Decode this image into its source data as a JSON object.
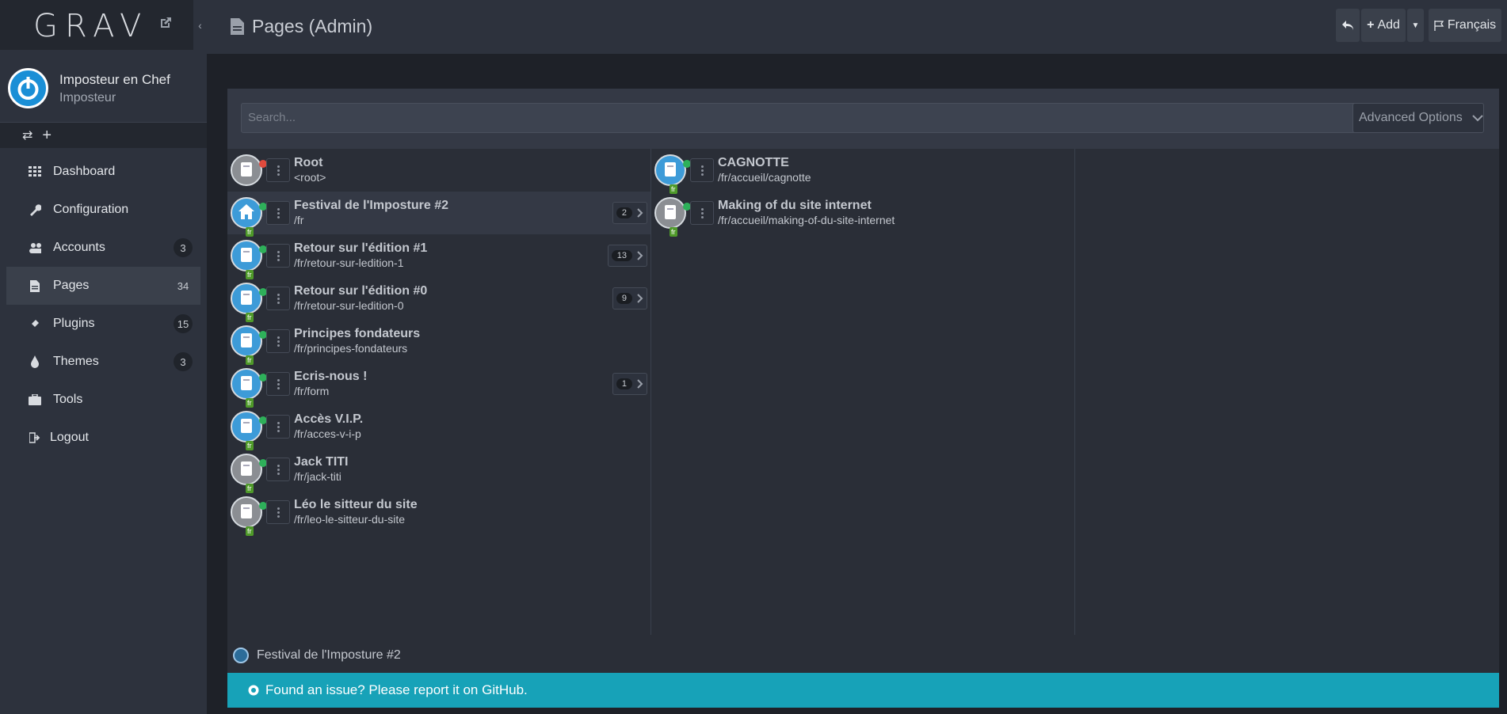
{
  "sidebar": {
    "logo": "GRAV",
    "user": {
      "name": "Imposteur en Chef",
      "role": "Imposteur"
    },
    "items": [
      {
        "label": "Dashboard",
        "icon": "dashboard-icon",
        "badge": ""
      },
      {
        "label": "Configuration",
        "icon": "wrench-icon",
        "badge": ""
      },
      {
        "label": "Accounts",
        "icon": "users-icon",
        "badge": "3"
      },
      {
        "label": "Pages",
        "icon": "file-icon",
        "badge": "34"
      },
      {
        "label": "Plugins",
        "icon": "plug-icon",
        "badge": "15"
      },
      {
        "label": "Themes",
        "icon": "tint-icon",
        "badge": "3"
      },
      {
        "label": "Tools",
        "icon": "briefcase-icon",
        "badge": ""
      },
      {
        "label": "Logout",
        "icon": "sign-out-icon",
        "badge": ""
      }
    ]
  },
  "header": {
    "title": "Pages (Admin)",
    "add_label": "Add",
    "lang_label": "Français"
  },
  "search": {
    "placeholder": "Search...",
    "advanced_label": "Advanced Options"
  },
  "pages_left": [
    {
      "title": "Root",
      "url": "<root>",
      "count": "",
      "lang": "",
      "color": "grey",
      "status": "red"
    },
    {
      "title": "Festival de l'Imposture #2",
      "url": "/fr",
      "count": "2",
      "lang": "fr",
      "color": "blue",
      "status": "green"
    },
    {
      "title": "Retour sur l'édition #1",
      "url": "/fr/retour-sur-ledition-1",
      "count": "13",
      "lang": "fr",
      "color": "blue",
      "status": "green"
    },
    {
      "title": "Retour sur l'édition #0",
      "url": "/fr/retour-sur-ledition-0",
      "count": "9",
      "lang": "fr",
      "color": "blue",
      "status": "green"
    },
    {
      "title": "Principes fondateurs",
      "url": "/fr/principes-fondateurs",
      "count": "",
      "lang": "fr",
      "color": "blue",
      "status": "green"
    },
    {
      "title": "Ecris-nous !",
      "url": "/fr/form",
      "count": "1",
      "lang": "fr",
      "color": "blue",
      "status": "green"
    },
    {
      "title": "Accès V.I.P.",
      "url": "/fr/acces-v-i-p",
      "count": "",
      "lang": "fr",
      "color": "blue",
      "status": "green"
    },
    {
      "title": "Jack TITI",
      "url": "/fr/jack-titi",
      "count": "",
      "lang": "fr",
      "color": "grey",
      "status": "green"
    },
    {
      "title": "Léo le sitteur du site",
      "url": "/fr/leo-le-sitteur-du-site",
      "count": "",
      "lang": "fr",
      "color": "grey",
      "status": "green"
    }
  ],
  "pages_right": [
    {
      "title": "CAGNOTTE",
      "url": "/fr/accueil/cagnotte",
      "lang": "fr",
      "color": "blue",
      "status": "green"
    },
    {
      "title": "Making of du site internet",
      "url": "/fr/accueil/making-of-du-site-internet",
      "lang": "fr",
      "color": "grey",
      "status": "green"
    }
  ],
  "breadcrumb": "Festival de l'Imposture #2",
  "footer": "Found an issue? Please report it on GitHub."
}
